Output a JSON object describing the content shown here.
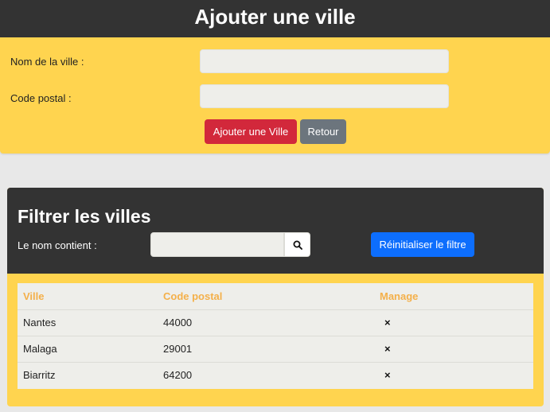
{
  "add_section": {
    "title": "Ajouter une ville",
    "city_name_label": "Nom de la ville :",
    "city_name_value": "",
    "city_name_placeholder": "",
    "postal_code_label": "Code postal :",
    "postal_code_value": "",
    "postal_code_placeholder": "",
    "add_button_label": "Ajouter une Ville",
    "back_button_label": "Retour"
  },
  "filter_section": {
    "title": "Filtrer les villes",
    "name_contains_label": "Le nom contient :",
    "name_contains_value": "",
    "name_contains_placeholder": "",
    "search_icon": "search-icon",
    "reset_button_label": "Réinitialiser le filtre"
  },
  "table": {
    "headers": [
      "Ville",
      "Code postal",
      "Manage"
    ],
    "rows": [
      {
        "city": "Nantes",
        "postal_code": "44000",
        "manage_icon": "close-icon",
        "manage_glyph": "×"
      },
      {
        "city": "Malaga",
        "postal_code": "29001",
        "manage_icon": "close-icon",
        "manage_glyph": "×"
      },
      {
        "city": "Biarritz",
        "postal_code": "64200",
        "manage_icon": "close-icon",
        "manage_glyph": "×"
      }
    ]
  },
  "colors": {
    "header_dark": "#333333",
    "card_yellow": "#ffd44f",
    "danger_red": "#d2283b",
    "secondary_gray": "#6c757d",
    "primary_blue": "#0d6efd",
    "table_header_orange": "#f4b04a"
  }
}
